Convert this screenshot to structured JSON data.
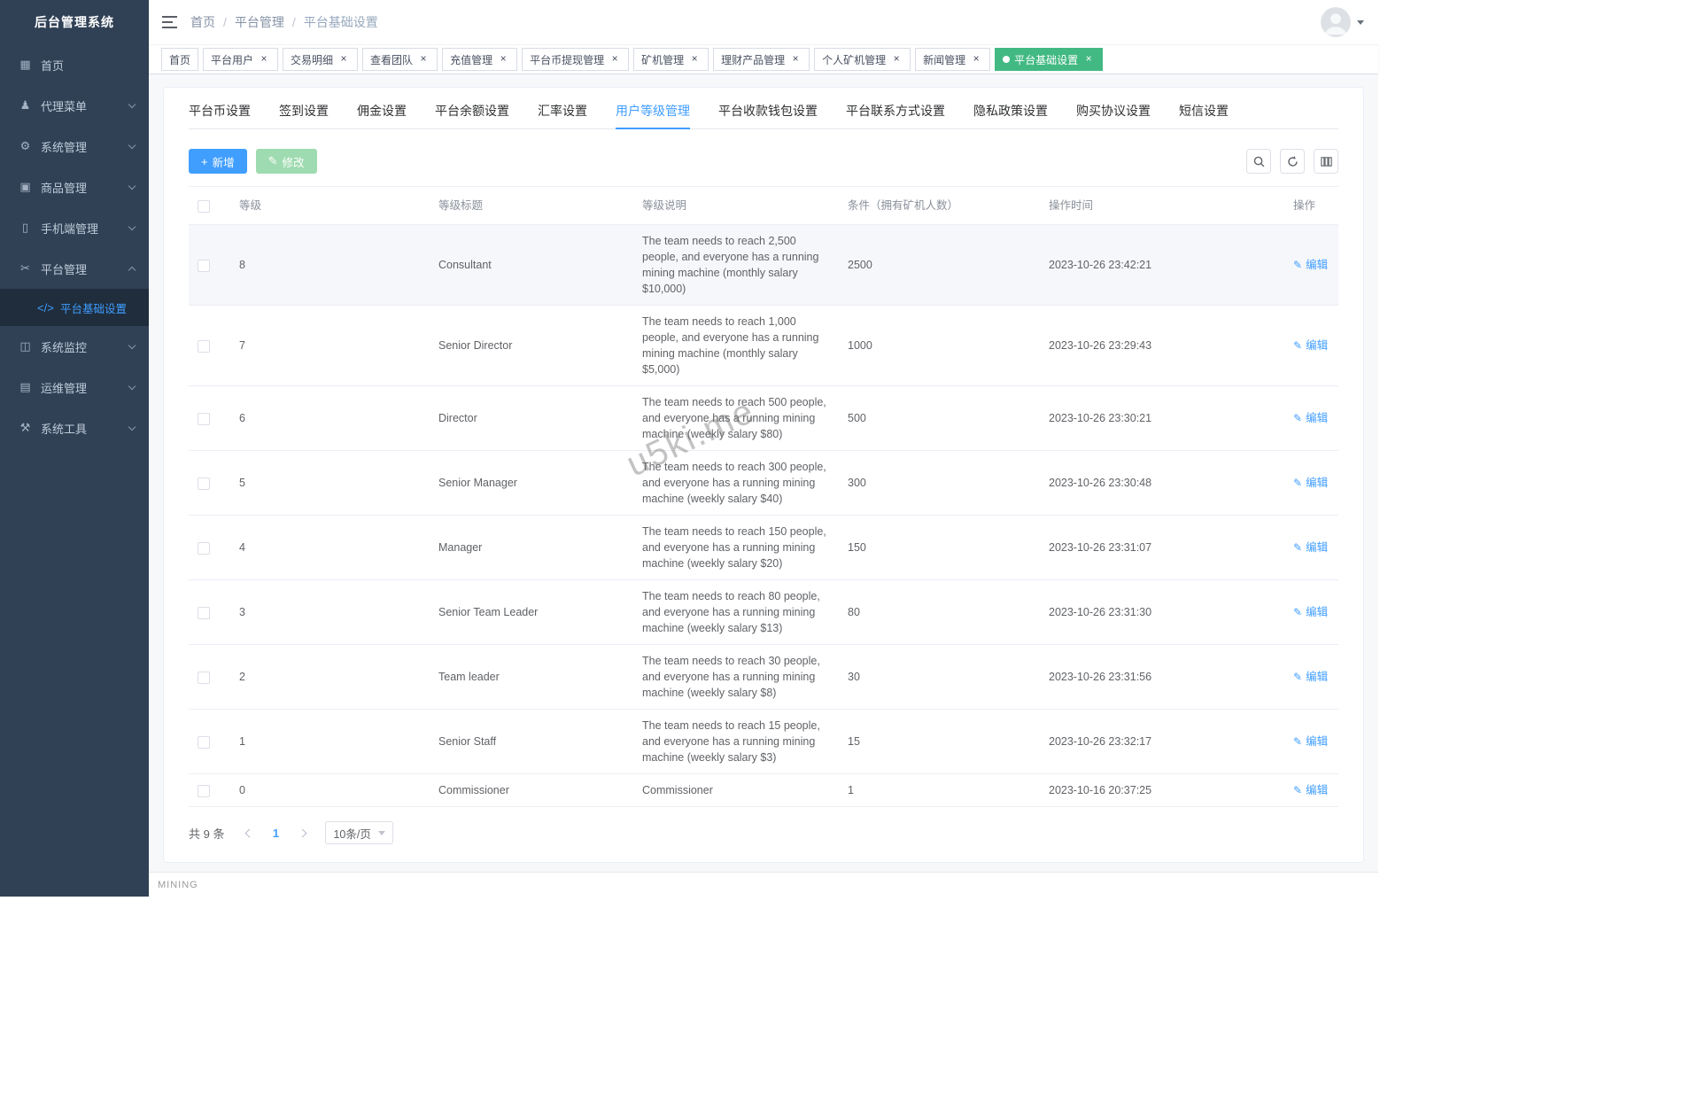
{
  "app": {
    "title": "后台管理系统",
    "footer_text": "MINING"
  },
  "colors": {
    "primary": "#409EFF",
    "tag_active_green": "#42b983",
    "sidebar_bg": "#304156",
    "sidebar_text": "#bfcbd9",
    "edit_button_disabled_green": "#9fdbb0"
  },
  "icons": {
    "add": "plus-icon",
    "edit": "pencil-icon",
    "close": "close-icon"
  },
  "watermark": "u5ki.me",
  "navbar": {
    "breadcrumb": [
      {
        "label": "首页"
      },
      {
        "label": "平台管理"
      },
      {
        "label": "平台基础设置"
      }
    ]
  },
  "tags": [
    {
      "label": "首页",
      "closable": false,
      "active": false
    },
    {
      "label": "平台用户",
      "closable": true,
      "active": false
    },
    {
      "label": "交易明细",
      "closable": true,
      "active": false
    },
    {
      "label": "查看团队",
      "closable": true,
      "active": false
    },
    {
      "label": "充值管理",
      "closable": true,
      "active": false
    },
    {
      "label": "平台币提现管理",
      "closable": true,
      "active": false
    },
    {
      "label": "矿机管理",
      "closable": true,
      "active": false
    },
    {
      "label": "理财产品管理",
      "closable": true,
      "active": false
    },
    {
      "label": "个人矿机管理",
      "closable": true,
      "active": false
    },
    {
      "label": "新闻管理",
      "closable": true,
      "active": false
    },
    {
      "label": "平台基础设置",
      "closable": true,
      "active": true
    }
  ],
  "sidebar": {
    "items": [
      {
        "label": "首页",
        "icon": "home-icon",
        "arrow": false,
        "child": false,
        "active": false,
        "expanded": false
      },
      {
        "label": "代理菜单",
        "icon": "agent-icon",
        "arrow": true,
        "child": false,
        "active": false,
        "expanded": false
      },
      {
        "label": "系统管理",
        "icon": "gear-icon",
        "arrow": true,
        "child": false,
        "active": false,
        "expanded": false
      },
      {
        "label": "商品管理",
        "icon": "goods-icon",
        "arrow": true,
        "child": false,
        "active": false,
        "expanded": false
      },
      {
        "label": "手机端管理",
        "icon": "mobile-icon",
        "arrow": true,
        "child": false,
        "active": false,
        "expanded": false
      },
      {
        "label": "平台管理",
        "icon": "platform-icon",
        "arrow": true,
        "child": false,
        "active": false,
        "expanded": true
      },
      {
        "label": "平台基础设置",
        "icon": "code-icon",
        "arrow": false,
        "child": true,
        "active": true,
        "expanded": false
      },
      {
        "label": "系统监控",
        "icon": "monitor-icon",
        "arrow": true,
        "child": false,
        "active": false,
        "expanded": false
      },
      {
        "label": "运维管理",
        "icon": "ops-icon",
        "arrow": true,
        "child": false,
        "active": false,
        "expanded": false
      },
      {
        "label": "系统工具",
        "icon": "tools-icon",
        "arrow": true,
        "child": false,
        "active": false,
        "expanded": false
      }
    ]
  },
  "page": {
    "tabs": [
      {
        "label": "平台币设置",
        "active": false
      },
      {
        "label": "签到设置",
        "active": false
      },
      {
        "label": "佣金设置",
        "active": false
      },
      {
        "label": "平台余额设置",
        "active": false
      },
      {
        "label": "汇率设置",
        "active": false
      },
      {
        "label": "用户等级管理",
        "active": true
      },
      {
        "label": "平台收款钱包设置",
        "active": false
      },
      {
        "label": "平台联系方式设置",
        "active": false
      },
      {
        "label": "隐私政策设置",
        "active": false
      },
      {
        "label": "购买协议设置",
        "active": false
      },
      {
        "label": "短信设置",
        "active": false
      }
    ],
    "toolbar": {
      "add": "新增",
      "edit": "修改"
    },
    "table": {
      "headers": [
        "等级",
        "等级标题",
        "等级说明",
        "条件（拥有矿机人数）",
        "操作时间",
        "操作"
      ],
      "edit_action": "编辑",
      "rows": [
        {
          "level": "8",
          "title": "Consultant",
          "desc": "The team needs to reach 2,500 people, and everyone has a running mining machine (monthly salary $10,000)",
          "condition": "2500",
          "time": "2023-10-26 23:42:21"
        },
        {
          "level": "7",
          "title": "Senior Director",
          "desc": "The team needs to reach 1,000 people, and everyone has a running mining machine (monthly salary $5,000)",
          "condition": "1000",
          "time": "2023-10-26 23:29:43"
        },
        {
          "level": "6",
          "title": "Director",
          "desc": "The team needs to reach 500 people, and everyone has a running mining machine (weekly salary $80)",
          "condition": "500",
          "time": "2023-10-26 23:30:21"
        },
        {
          "level": "5",
          "title": "Senior Manager",
          "desc": "The team needs to reach 300 people, and everyone has a running mining machine (weekly salary $40)",
          "condition": "300",
          "time": "2023-10-26 23:30:48"
        },
        {
          "level": "4",
          "title": "Manager",
          "desc": "The team needs to reach 150 people, and everyone has a running mining machine (weekly salary $20)",
          "condition": "150",
          "time": "2023-10-26 23:31:07"
        },
        {
          "level": "3",
          "title": "Senior Team Leader",
          "desc": "The team needs to reach 80 people, and everyone has a running mining machine (weekly salary $13)",
          "condition": "80",
          "time": "2023-10-26 23:31:30"
        },
        {
          "level": "2",
          "title": "Team leader",
          "desc": "The team needs to reach 30 people, and everyone has a running mining machine (weekly salary $8)",
          "condition": "30",
          "time": "2023-10-26 23:31:56"
        },
        {
          "level": "1",
          "title": "Senior Staff",
          "desc": "The team needs to reach 15 people, and everyone has a running mining machine (weekly salary $3)",
          "condition": "15",
          "time": "2023-10-26 23:32:17"
        },
        {
          "level": "0",
          "title": "Commissioner",
          "desc": "Commissioner",
          "condition": "1",
          "time": "2023-10-16 20:37:25"
        }
      ]
    },
    "pagination": {
      "total": "共 9 条",
      "page": "1",
      "size": "10条/页"
    }
  }
}
